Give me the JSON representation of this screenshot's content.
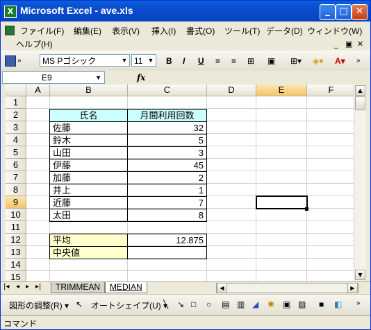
{
  "window": {
    "title": "Microsoft Excel - ave.xls",
    "app_icon": "X"
  },
  "menu": {
    "items": [
      "ファイル(F)",
      "編集(E)",
      "表示(V)",
      "挿入(I)",
      "書式(O)",
      "ツール(T)",
      "データ(D)",
      "ウィンドウ(W)",
      "ヘルプ(H)"
    ]
  },
  "toolbar": {
    "font_name": "MS Pゴシック",
    "font_size": "11",
    "bold": "B",
    "italic": "I",
    "underline": "U",
    "font_color_letter": "A"
  },
  "formula_bar": {
    "name_box": "E9",
    "fx": "fx",
    "content": ""
  },
  "columns": [
    "A",
    "B",
    "C",
    "D",
    "E",
    "F"
  ],
  "rows": [
    "1",
    "2",
    "3",
    "4",
    "5",
    "6",
    "7",
    "8",
    "9",
    "10",
    "11",
    "12",
    "13",
    "14",
    "15"
  ],
  "selected_cell": "E9",
  "table": {
    "headers": [
      "氏名",
      "月間利用回数"
    ],
    "rows": [
      [
        "佐藤",
        "32"
      ],
      [
        "鈴木",
        "5"
      ],
      [
        "山田",
        "3"
      ],
      [
        "伊藤",
        "45"
      ],
      [
        "加藤",
        "2"
      ],
      [
        "井上",
        "1"
      ],
      [
        "近藤",
        "7"
      ],
      [
        "太田",
        "8"
      ]
    ]
  },
  "summary": [
    {
      "label": "平均",
      "value": "12.875"
    },
    {
      "label": "中央値",
      "value": ""
    }
  ],
  "sheet_tabs": [
    "TRIMMEAN",
    "MEDIAN"
  ],
  "active_sheet": "MEDIAN",
  "drawing_toolbar": {
    "draw_label": "図形の調整(R)",
    "autoshape_label": "オートシェイプ(U)"
  },
  "status": {
    "text": "コマンド"
  },
  "colors": {
    "header_fill": "#ccffff",
    "summary_fill": "#ffffcc",
    "title_bar": "#0a5fd8"
  },
  "icons": [
    "excel-app-icon",
    "minimize-icon",
    "maximize-icon",
    "close-icon",
    "save-icon",
    "align-left-icon",
    "align-center-icon",
    "merge-center-icon",
    "currency-icon",
    "borders-icon",
    "fill-color-icon",
    "font-color-icon",
    "cursor-icon",
    "line-icon",
    "arrow-icon",
    "rectangle-icon",
    "oval-icon",
    "textbox-icon",
    "wordart-icon",
    "clipart-icon",
    "picture-icon"
  ]
}
